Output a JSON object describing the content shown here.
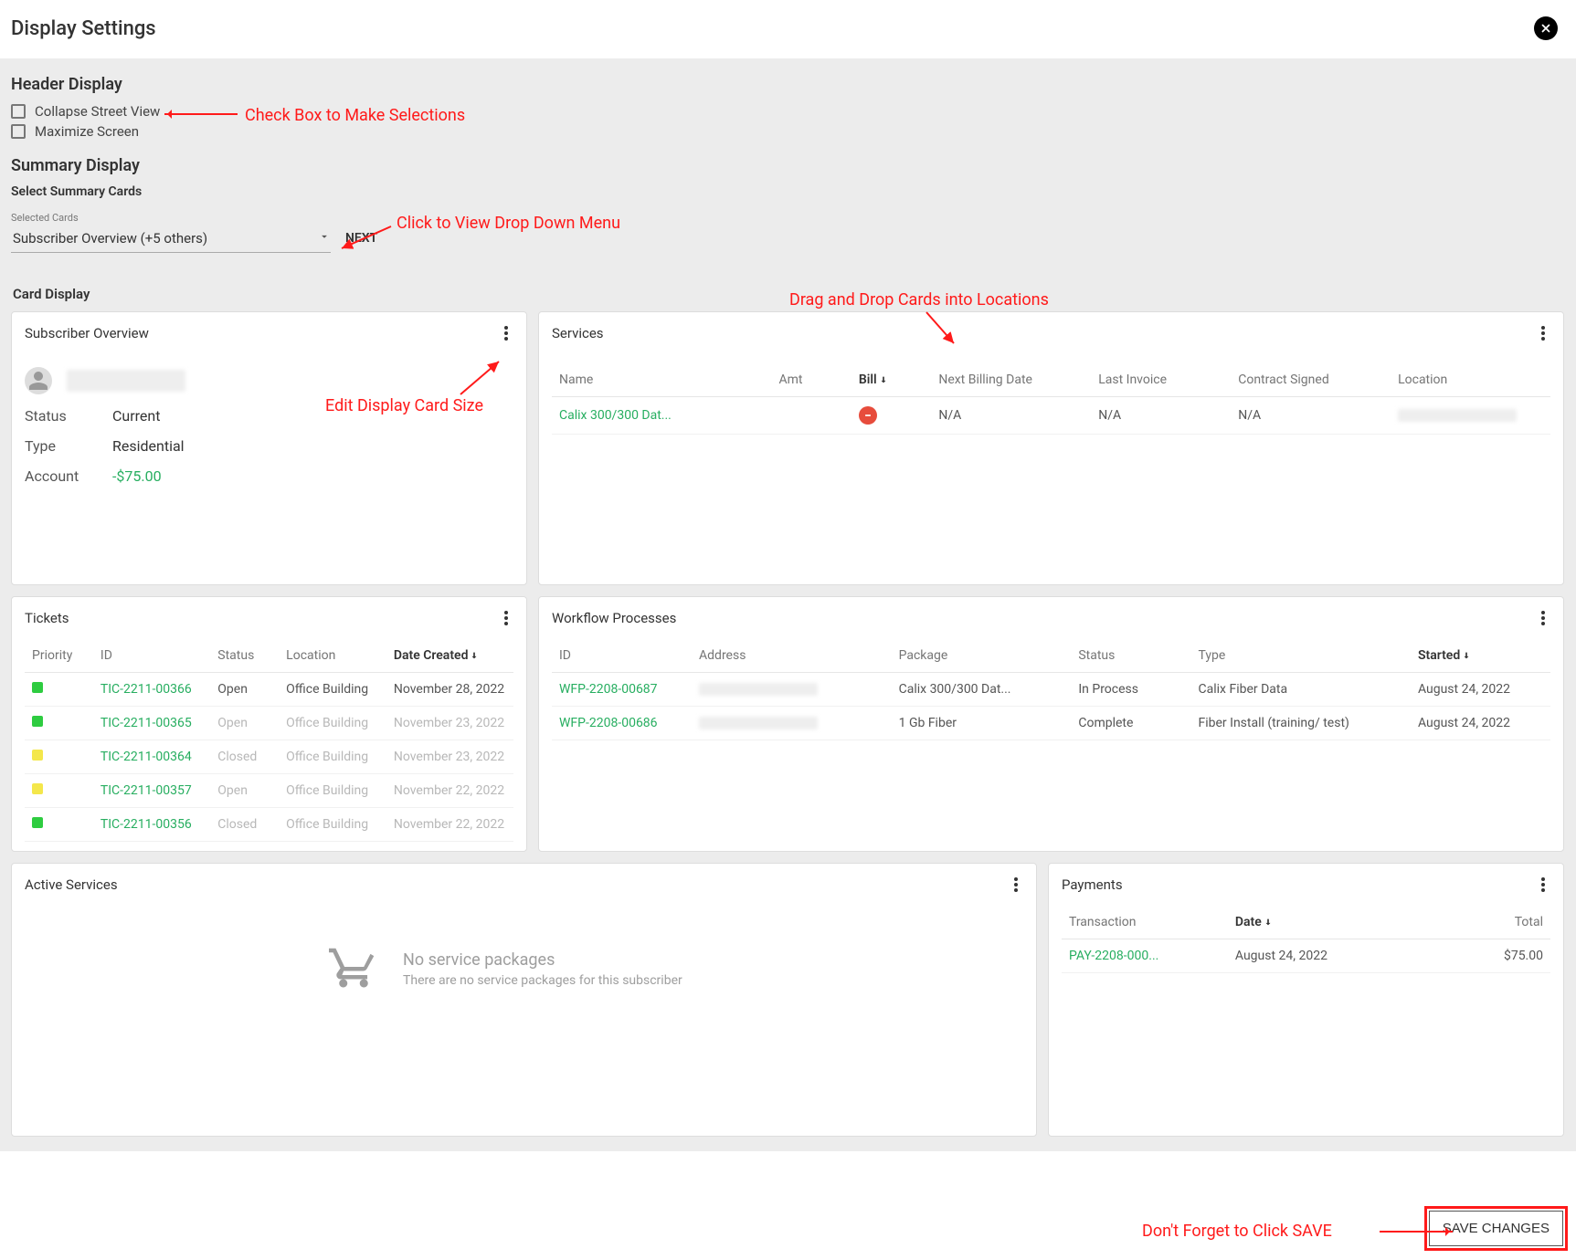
{
  "title": "Display Settings",
  "header_display": {
    "heading": "Header Display",
    "collapse_street": "Collapse Street View",
    "maximize_screen": "Maximize Screen"
  },
  "summary_display": {
    "heading": "Summary Display",
    "select_heading": "Select Summary Cards",
    "selected_label": "Selected Cards",
    "selected_value": "Subscriber Overview (+5 others)",
    "next_btn": "NEXT"
  },
  "card_display_heading": "Card Display",
  "annotations": {
    "checkbox_hint": "Check Box to Make Selections",
    "dropdown_hint": "Click to View Drop Down Menu",
    "drag_hint": "Drag and Drop Cards into Locations",
    "menu_hint": "Edit Display Card Size",
    "save_hint": "Don't Forget to Click SAVE"
  },
  "subscriber_card": {
    "title": "Subscriber Overview",
    "status_k": "Status",
    "status_v": "Current",
    "type_k": "Type",
    "type_v": "Residential",
    "account_k": "Account",
    "account_v": "-$75.00"
  },
  "services_card": {
    "title": "Services",
    "cols": {
      "name": "Name",
      "amt": "Amt",
      "bill": "Bill",
      "next": "Next Billing Date",
      "last": "Last Invoice",
      "contract": "Contract Signed",
      "location": "Location"
    },
    "rows": [
      {
        "name": "Calix 300/300 Dat...",
        "amt": "",
        "bill_bad": true,
        "next": "N/A",
        "last": "N/A",
        "contract": "N/A",
        "location_blur": true
      }
    ]
  },
  "tickets_card": {
    "title": "Tickets",
    "cols": {
      "priority": "Priority",
      "id": "ID",
      "status": "Status",
      "location": "Location",
      "date": "Date Created"
    },
    "rows": [
      {
        "color": "green",
        "id": "TIC-2211-00366",
        "status": "Open",
        "location": "Office Building",
        "date": "November 28, 2022",
        "dim": false
      },
      {
        "color": "green",
        "id": "TIC-2211-00365",
        "status": "Open",
        "location": "Office Building",
        "date": "November 23, 2022",
        "dim": true
      },
      {
        "color": "yellow",
        "id": "TIC-2211-00364",
        "status": "Closed",
        "location": "Office Building",
        "date": "November 23, 2022",
        "dim": true
      },
      {
        "color": "yellow",
        "id": "TIC-2211-00357",
        "status": "Open",
        "location": "Office Building",
        "date": "November 22, 2022",
        "dim": true
      },
      {
        "color": "green",
        "id": "TIC-2211-00356",
        "status": "Closed",
        "location": "Office Building",
        "date": "November 22, 2022",
        "dim": true
      }
    ]
  },
  "workflow_card": {
    "title": "Workflow Processes",
    "cols": {
      "id": "ID",
      "address": "Address",
      "package": "Package",
      "status": "Status",
      "type": "Type",
      "started": "Started"
    },
    "rows": [
      {
        "id": "WFP-2208-00687",
        "package": "Calix 300/300 Dat...",
        "status": "In Process",
        "type": "Calix Fiber Data",
        "started": "August 24, 2022"
      },
      {
        "id": "WFP-2208-00686",
        "package": "1 Gb Fiber",
        "status": "Complete",
        "type": "Fiber Install (training/ test)",
        "started": "August 24, 2022"
      }
    ]
  },
  "active_card": {
    "title": "Active Services",
    "empty_title": "No service packages",
    "empty_sub": "There are no service packages for this subscriber"
  },
  "payments_card": {
    "title": "Payments",
    "cols": {
      "txn": "Transaction",
      "date": "Date",
      "total": "Total"
    },
    "rows": [
      {
        "txn": "PAY-2208-000...",
        "date": "August 24, 2022",
        "total": "$75.00"
      }
    ]
  },
  "save_btn": "SAVE CHANGES"
}
